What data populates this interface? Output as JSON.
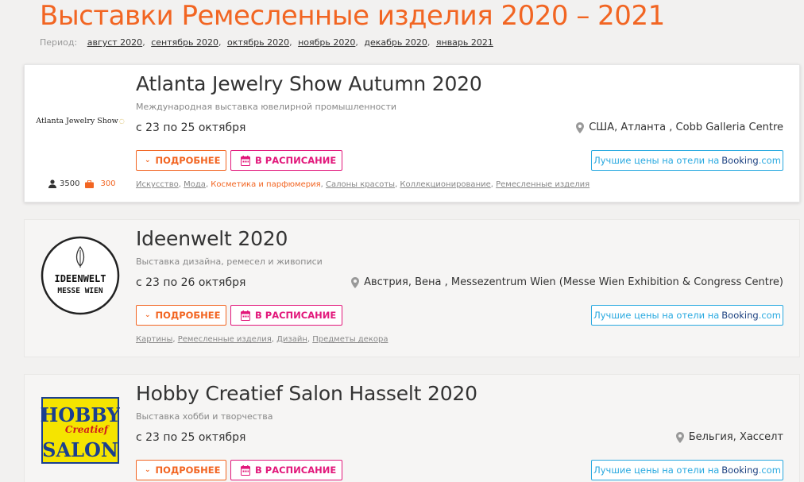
{
  "page": {
    "title": "Выставки Ремесленные изделия 2020 – 2021",
    "period_label": "Период:",
    "periods": [
      "август 2020",
      "сентябрь 2020",
      "октябрь 2020",
      "ноябрь 2020",
      "декабрь 2020",
      "январь 2021"
    ]
  },
  "colors": {
    "accent": "#f26522",
    "schedule": "#e2187b",
    "hotel": "#29a9e0",
    "booking_dark": "#1a3f7f"
  },
  "buttons": {
    "more": "ПОДРОБНЕЕ",
    "schedule": "В РАСПИСАНИЕ",
    "hotel_prefix": "Лучшие цены на отели на",
    "booking_brand": "Booking",
    "booking_tld": ".com"
  },
  "events": [
    {
      "title": "Atlanta Jewelry Show Autumn 2020",
      "subtitle": "Международная выставка ювелирной промышленности",
      "dates": "с 23 по 25 октября",
      "location": "США, Атланта , Cobb Galleria Centre",
      "logo_text": "Atlanta Jewelry Show",
      "visitors": "3500",
      "exhibitors": "300",
      "tags": [
        "Искусство",
        "Мода",
        "Косметика и парфюмерия",
        "Салоны красоты",
        "Коллекционирование",
        "Ремесленные изделия"
      ]
    },
    {
      "title": "Ideenwelt 2020",
      "subtitle": "Выставка дизайна, ремесел и живописи",
      "dates": "с 23 по 26 октября",
      "location": "Австрия, Вена , Messezentrum Wien (Messe Wien Exhibition & Congress Centre)",
      "logo_text_1": "IDEENWELT",
      "logo_text_2": "MESSE WIEN",
      "tags": [
        "Картины",
        "Ремесленные изделия",
        "Дизайн",
        "Предметы декора"
      ]
    },
    {
      "title": "Hobby Creatief Salon Hasselt 2020",
      "subtitle": "Выставка хобби и творчества",
      "dates": "с 23 по 25 октября",
      "location": "Бельгия, Хасселт",
      "logo_text_1": "HOBBY",
      "logo_text_2": "Creatief",
      "logo_text_3": "SALON"
    }
  ]
}
